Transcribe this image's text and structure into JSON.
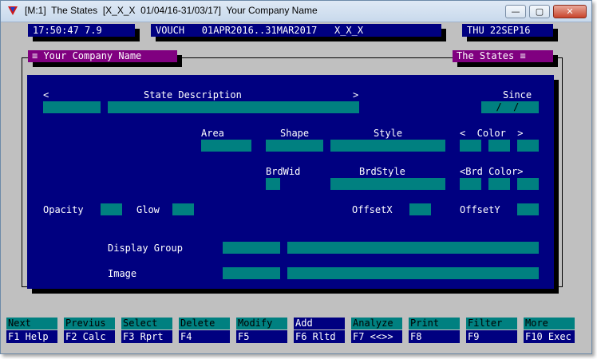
{
  "window": {
    "title": "[M:1]  The States  [X_X_X  01/04/16-31/03/17]  Your Company Name",
    "minimize_glyph": "—",
    "maximize_glyph": "▢",
    "close_glyph": "✕"
  },
  "status_bar": {
    "time": "17:50:47 7.9",
    "voucher": "VOUCH   01APR2016..31MAR2017   X_X_X",
    "date": "THU 22SEP16"
  },
  "frame": {
    "company_tag": "≡ Your Company Name",
    "module_tag": "The States ≡"
  },
  "form": {
    "state_prev_arrow": "<",
    "state_description_label": "State Description",
    "state_next_arrow": ">",
    "since_label": "Since",
    "since_value": "  /  /",
    "area_label": "Area",
    "shape_label": "Shape",
    "style_label": "Style",
    "color_label": "<  Color  >",
    "brdwid_label": "BrdWid",
    "brdstyle_label": "BrdStyle",
    "brd_color_label": "<Brd Color>",
    "opacity_label": "Opacity",
    "glow_label": "Glow",
    "offsetx_label": "OffsetX",
    "offsety_label": "OffsetY",
    "display_group_label": "Display Group",
    "image_label": "Image"
  },
  "function_keys": [
    {
      "action": "Next",
      "key": "F1 Help"
    },
    {
      "action": "Previus",
      "key": "F2 Calc"
    },
    {
      "action": "Select",
      "key": "F3 Rprt"
    },
    {
      "action": "Delete",
      "key": "F4"
    },
    {
      "action": "Modify",
      "key": "F5"
    },
    {
      "action": "Add",
      "key": "F6 Rltd"
    },
    {
      "action": "Analyze",
      "key": "F7 <<>>"
    },
    {
      "action": "Print",
      "key": "F8"
    },
    {
      "action": "Filter",
      "key": "F9"
    },
    {
      "action": "More",
      "key": "F10 Exec"
    }
  ],
  "colors": {
    "panel_blue": "#000080",
    "field_teal": "#008080",
    "tag_purple": "#800080",
    "window_gray": "#c0c0c0"
  }
}
